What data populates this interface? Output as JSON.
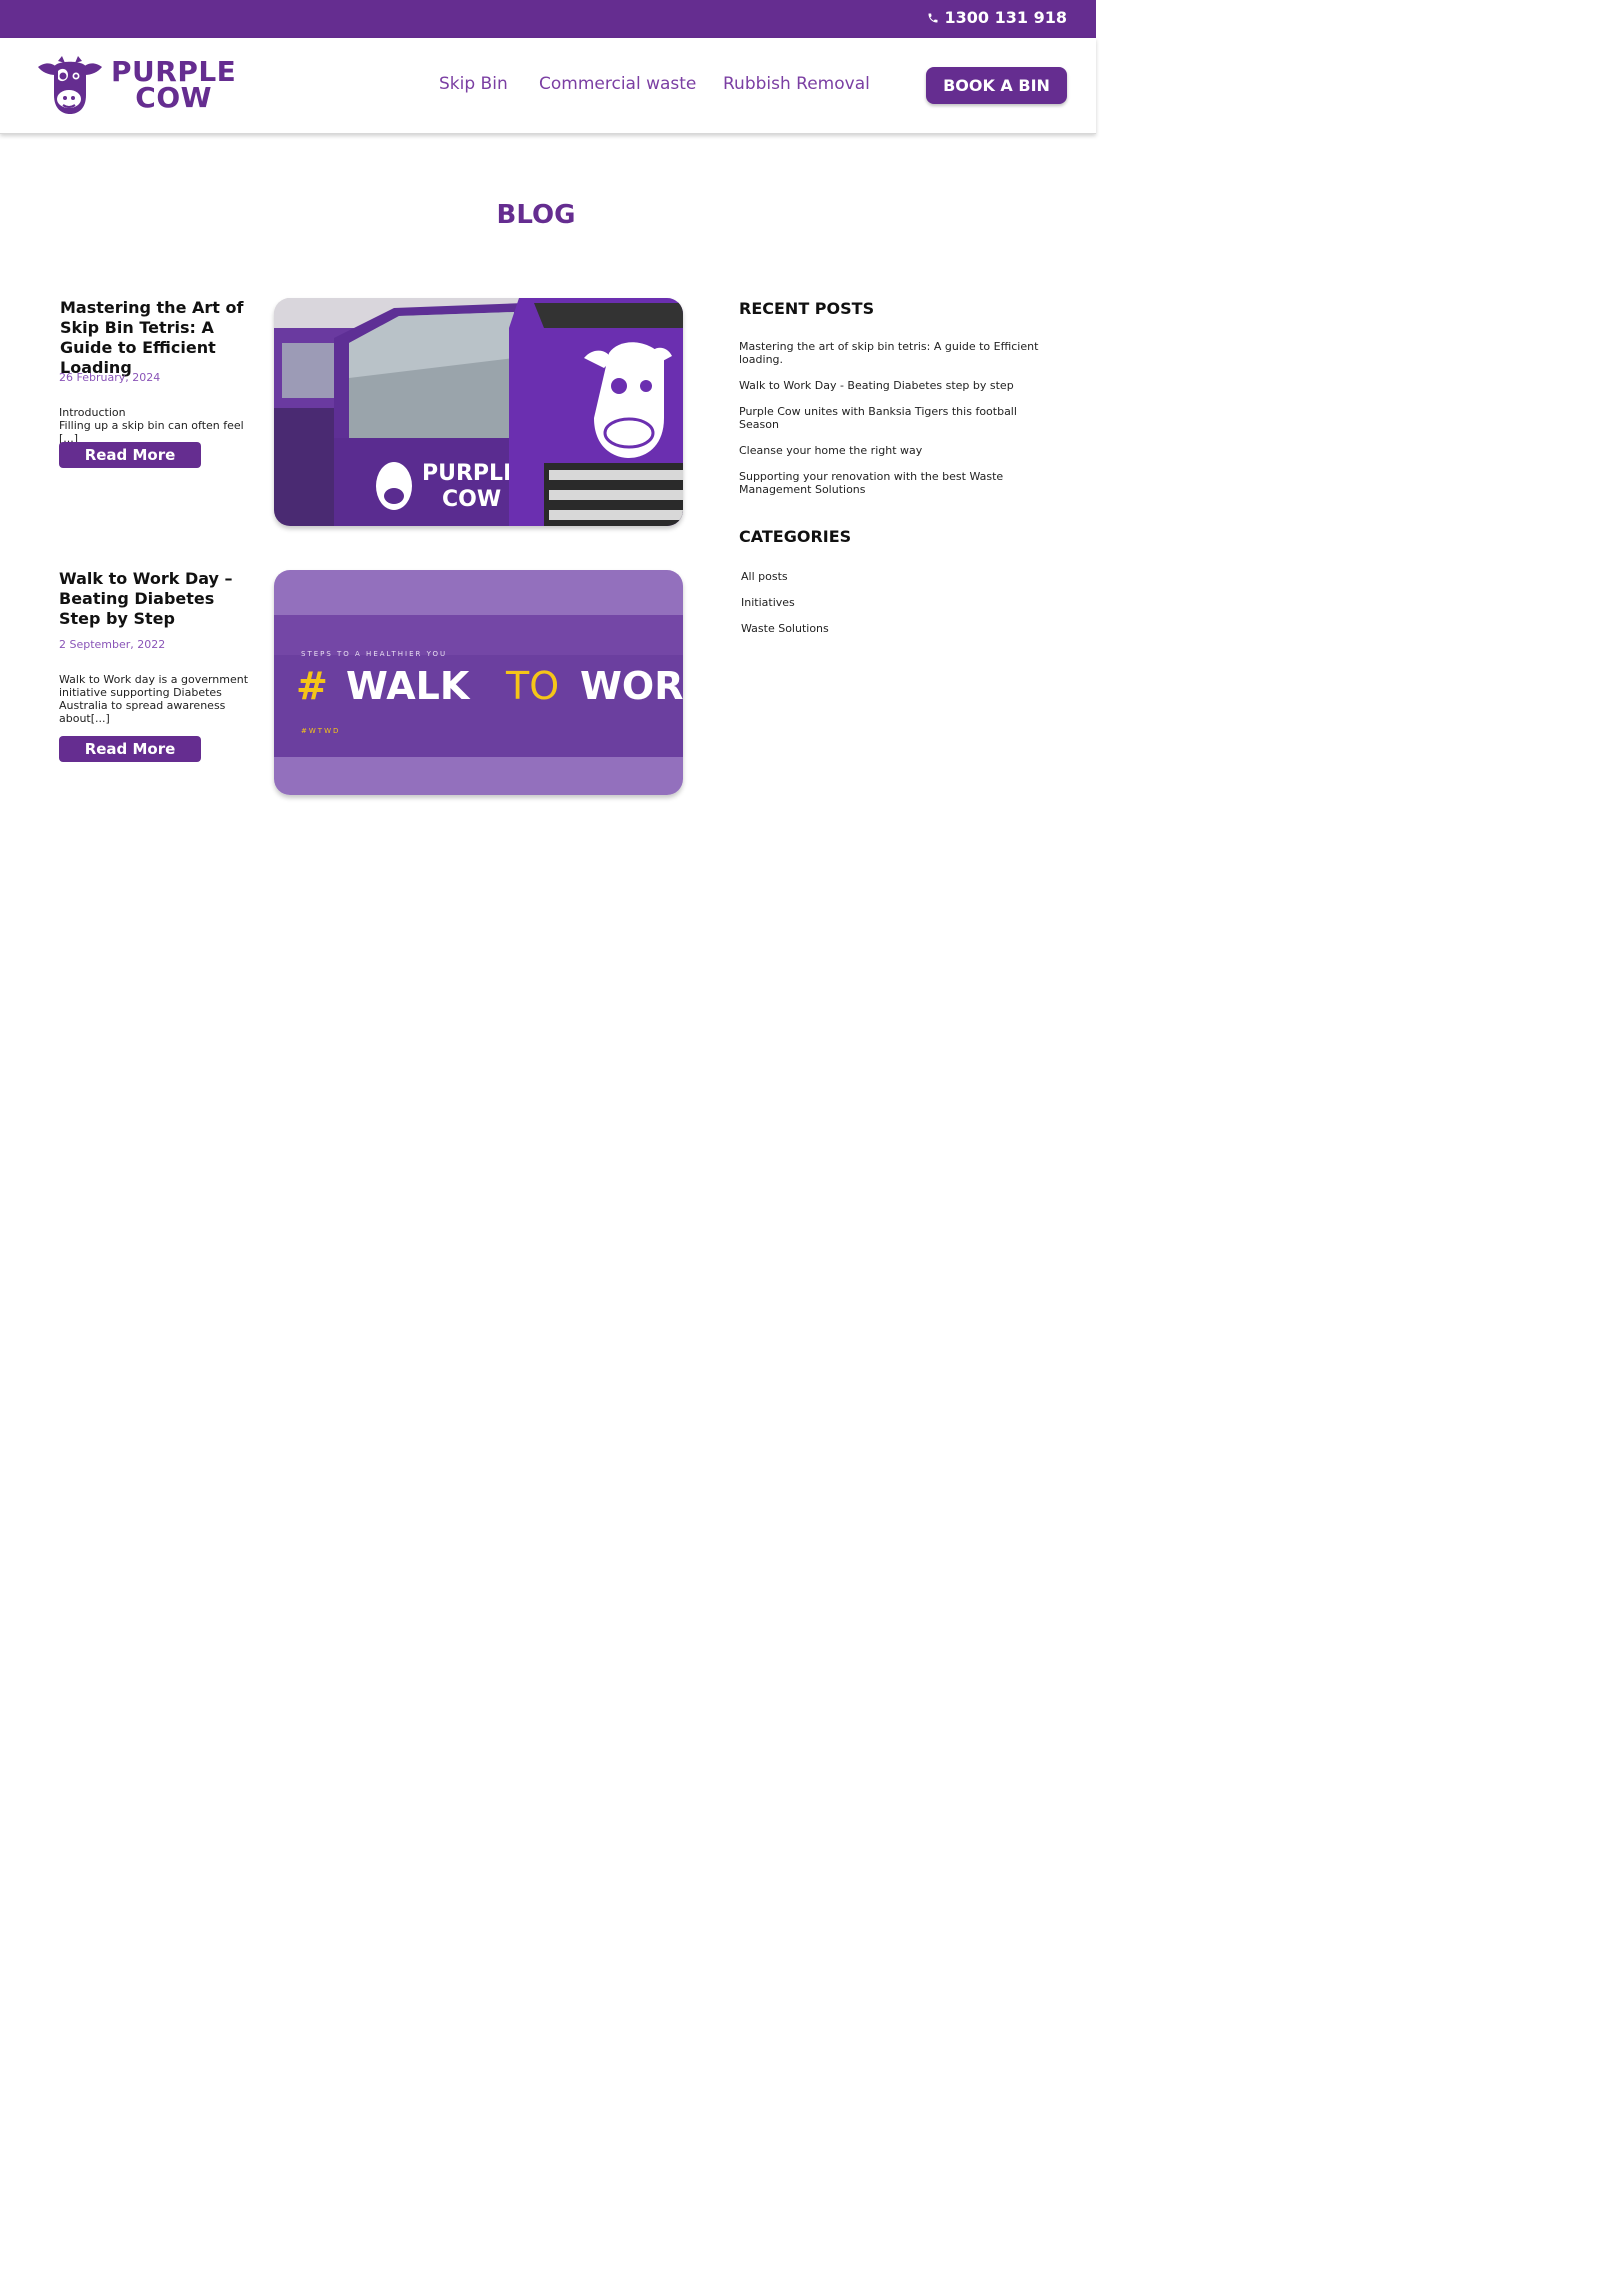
{
  "topbar": {
    "phone": "1300 131 918",
    "phone_icon": "phone-icon"
  },
  "header": {
    "logo": {
      "line1": "PURPLE",
      "line2": "COW",
      "icon": "cow-head-icon"
    },
    "nav": [
      "Skip Bin",
      "Commercial waste",
      "Rubbish Removal"
    ],
    "cta": "BOOK A BIN"
  },
  "page": {
    "title": "BLOG"
  },
  "posts": [
    {
      "title": "Mastering the Art of Skip Bin Tetris: A Guide to Efficient Loading",
      "date": "26 February, 2024",
      "excerpt_line1": "Introduction",
      "excerpt_line2": "Filling up a skip bin can often feel [...]",
      "read_more": "Read More",
      "image_text": {
        "truck_logo_1": "PURPLE",
        "truck_logo_2": "COW"
      }
    },
    {
      "title": "Walk to Work Day – Beating Diabetes Step by Step",
      "date": "2 September, 2022",
      "excerpt": "Walk to Work day is a government initiative supporting Diabetes Australia to spread awareness about[...]",
      "read_more": "Read More",
      "image_text": {
        "tagline": "STEPS TO A HEALTHIER YOU",
        "hash": "#",
        "walk": "WALK",
        "to": "TO",
        "work": "WORK",
        "hashtag": "#WTWD"
      }
    }
  ],
  "sidebar": {
    "recent_heading": "RECENT POSTS",
    "recent_posts": [
      "Mastering the art of skip bin tetris: A guide to Efficient loading.",
      "Walk to Work Day - Beating Diabetes step by step",
      "Purple Cow unites with Banksia Tigers this football Season",
      "Cleanse your home the right way",
      "Supporting your renovation with the best Waste Management Solutions"
    ],
    "categories_heading": "CATEGORIES",
    "categories": [
      "All posts",
      "Initiatives",
      "Waste Solutions"
    ]
  },
  "colors": {
    "brand_purple": "#652d90",
    "date_purple": "#8a55b8",
    "walk_yellow": "#f5c518"
  }
}
